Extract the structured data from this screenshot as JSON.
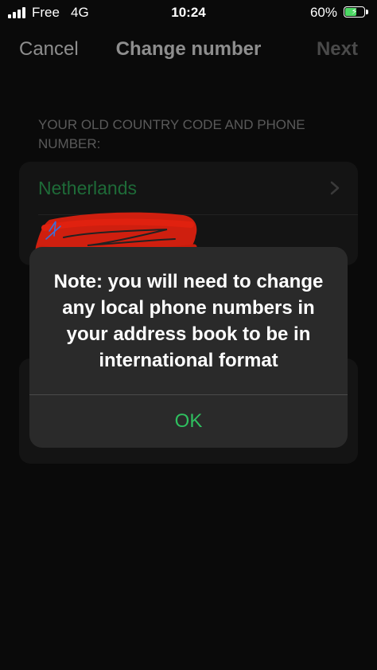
{
  "status_bar": {
    "carrier": "Free",
    "network": "4G",
    "time": "10:24",
    "battery_percent": "60%",
    "battery_level": 0.6,
    "battery_color": "#4cd964",
    "icons": [
      "signal-icon",
      "battery-icon",
      "charging-bolt-icon"
    ]
  },
  "nav": {
    "cancel_label": "Cancel",
    "title": "Change number",
    "next_label": "Next"
  },
  "old_number_section": {
    "header": "YOUR OLD COUNTRY CODE AND PHONE NUMBER:",
    "country": "Netherlands",
    "country_color": "#1e6b38",
    "chevron_icon": "chevron-right-icon"
  },
  "alert": {
    "message": "Note: you will need to change any local phone numbers in your address book to be in international format",
    "ok_label": "OK",
    "ok_color": "#2fbf5f"
  },
  "redaction_color": "#e0210f"
}
